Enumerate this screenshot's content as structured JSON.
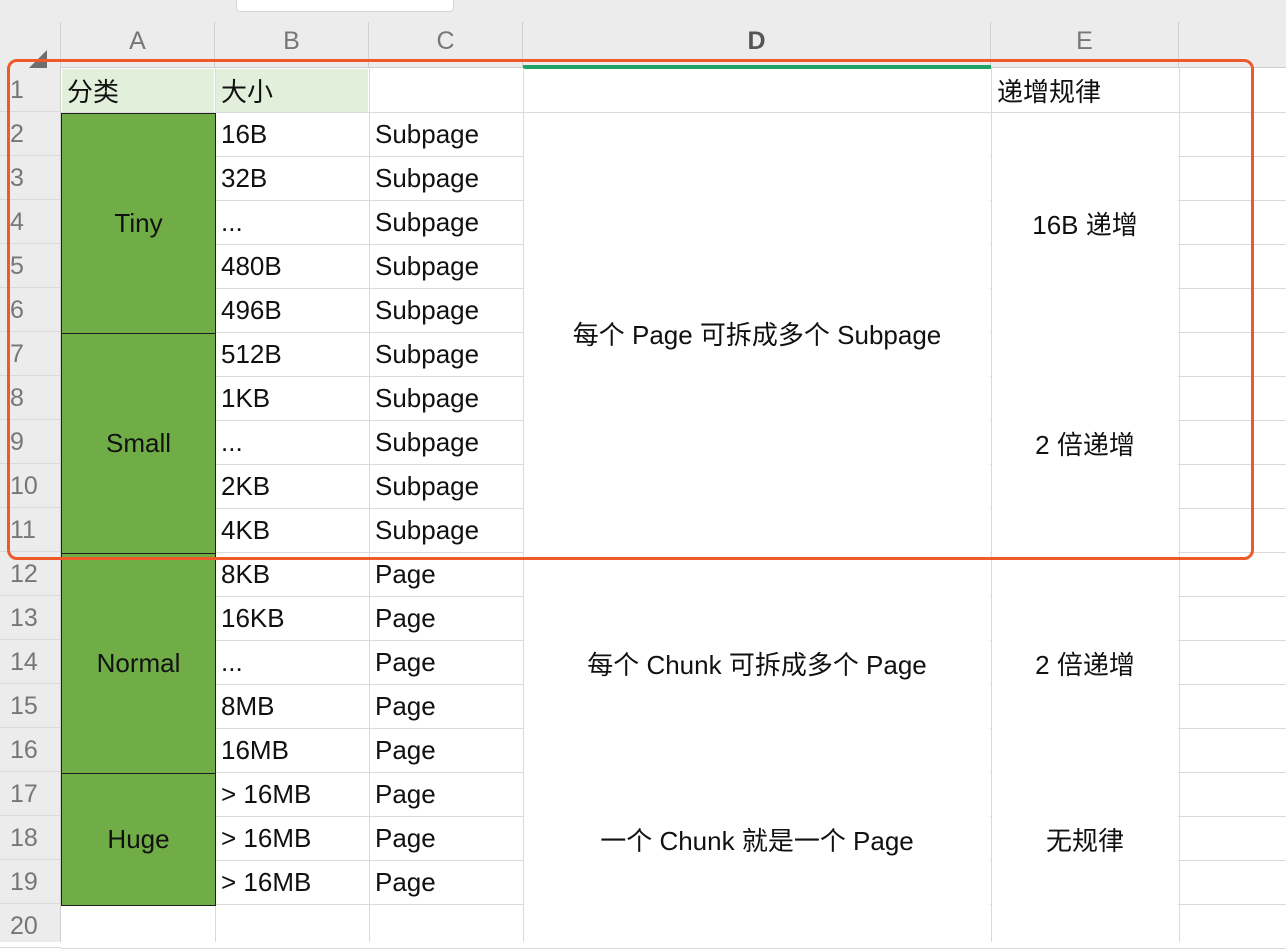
{
  "columns": [
    "A",
    "B",
    "C",
    "D",
    "E"
  ],
  "rows": [
    "1",
    "2",
    "3",
    "4",
    "5",
    "6",
    "7",
    "8",
    "9",
    "10",
    "11",
    "12",
    "13",
    "14",
    "15",
    "16",
    "17",
    "18",
    "19",
    "20"
  ],
  "header": {
    "category": "分类",
    "size": "大小",
    "rule": "递增规律"
  },
  "categories": [
    "Tiny",
    "Small",
    "Normal",
    "Huge"
  ],
  "sizes": [
    "16B",
    "32B",
    "...",
    "480B",
    "496B",
    "512B",
    "1KB",
    "...",
    "2KB",
    "4KB",
    "8KB",
    "16KB",
    "...",
    "8MB",
    "16MB",
    "> 16MB",
    "> 16MB",
    "> 16MB"
  ],
  "types": [
    "Subpage",
    "Subpage",
    "Subpage",
    "Subpage",
    "Subpage",
    "Subpage",
    "Subpage",
    "Subpage",
    "Subpage",
    "Subpage",
    "Page",
    "Page",
    "Page",
    "Page",
    "Page",
    "Page",
    "Page",
    "Page"
  ],
  "descriptions": [
    "每个 Page 可拆成多个 Subpage",
    "每个 Chunk 可拆成多个 Page",
    "一个 Chunk 就是一个 Page"
  ],
  "rules": [
    "16B 递增",
    "2 倍递增",
    "2 倍递增",
    "无规律"
  ],
  "colors": {
    "category_fill": "#70ad47",
    "header_fill": "#e2efda",
    "highlight": "#f05a2a",
    "active_column": "#21a366"
  }
}
